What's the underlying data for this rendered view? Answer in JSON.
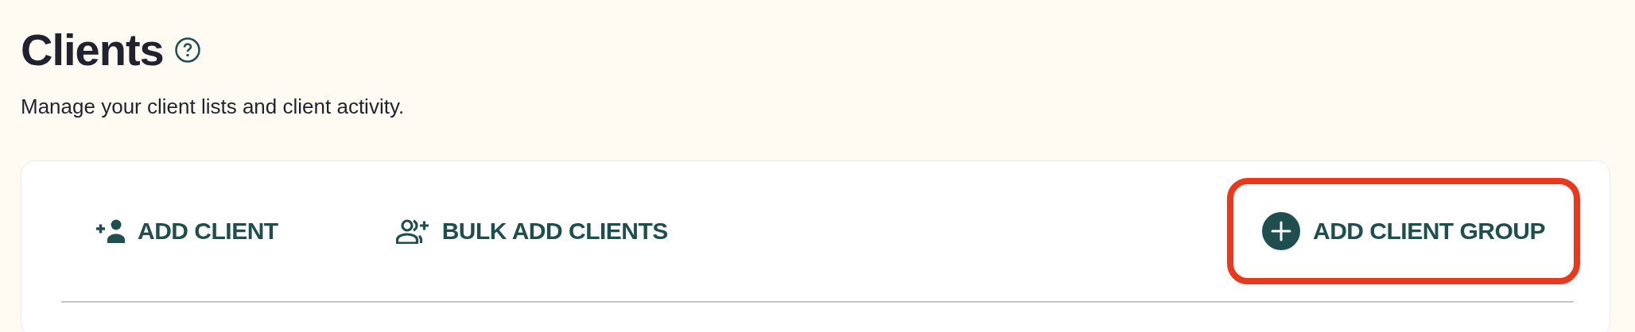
{
  "header": {
    "title": "Clients",
    "subtitle": "Manage your client lists and client activity."
  },
  "actions": [
    {
      "kind": "add-person",
      "label": "ADD CLIENT",
      "highlighted": false
    },
    {
      "kind": "bulk-add",
      "label": "BULK ADD CLIENTS",
      "highlighted": false
    },
    {
      "kind": "add-group",
      "label": "ADD CLIENT GROUP",
      "highlighted": true
    }
  ]
}
